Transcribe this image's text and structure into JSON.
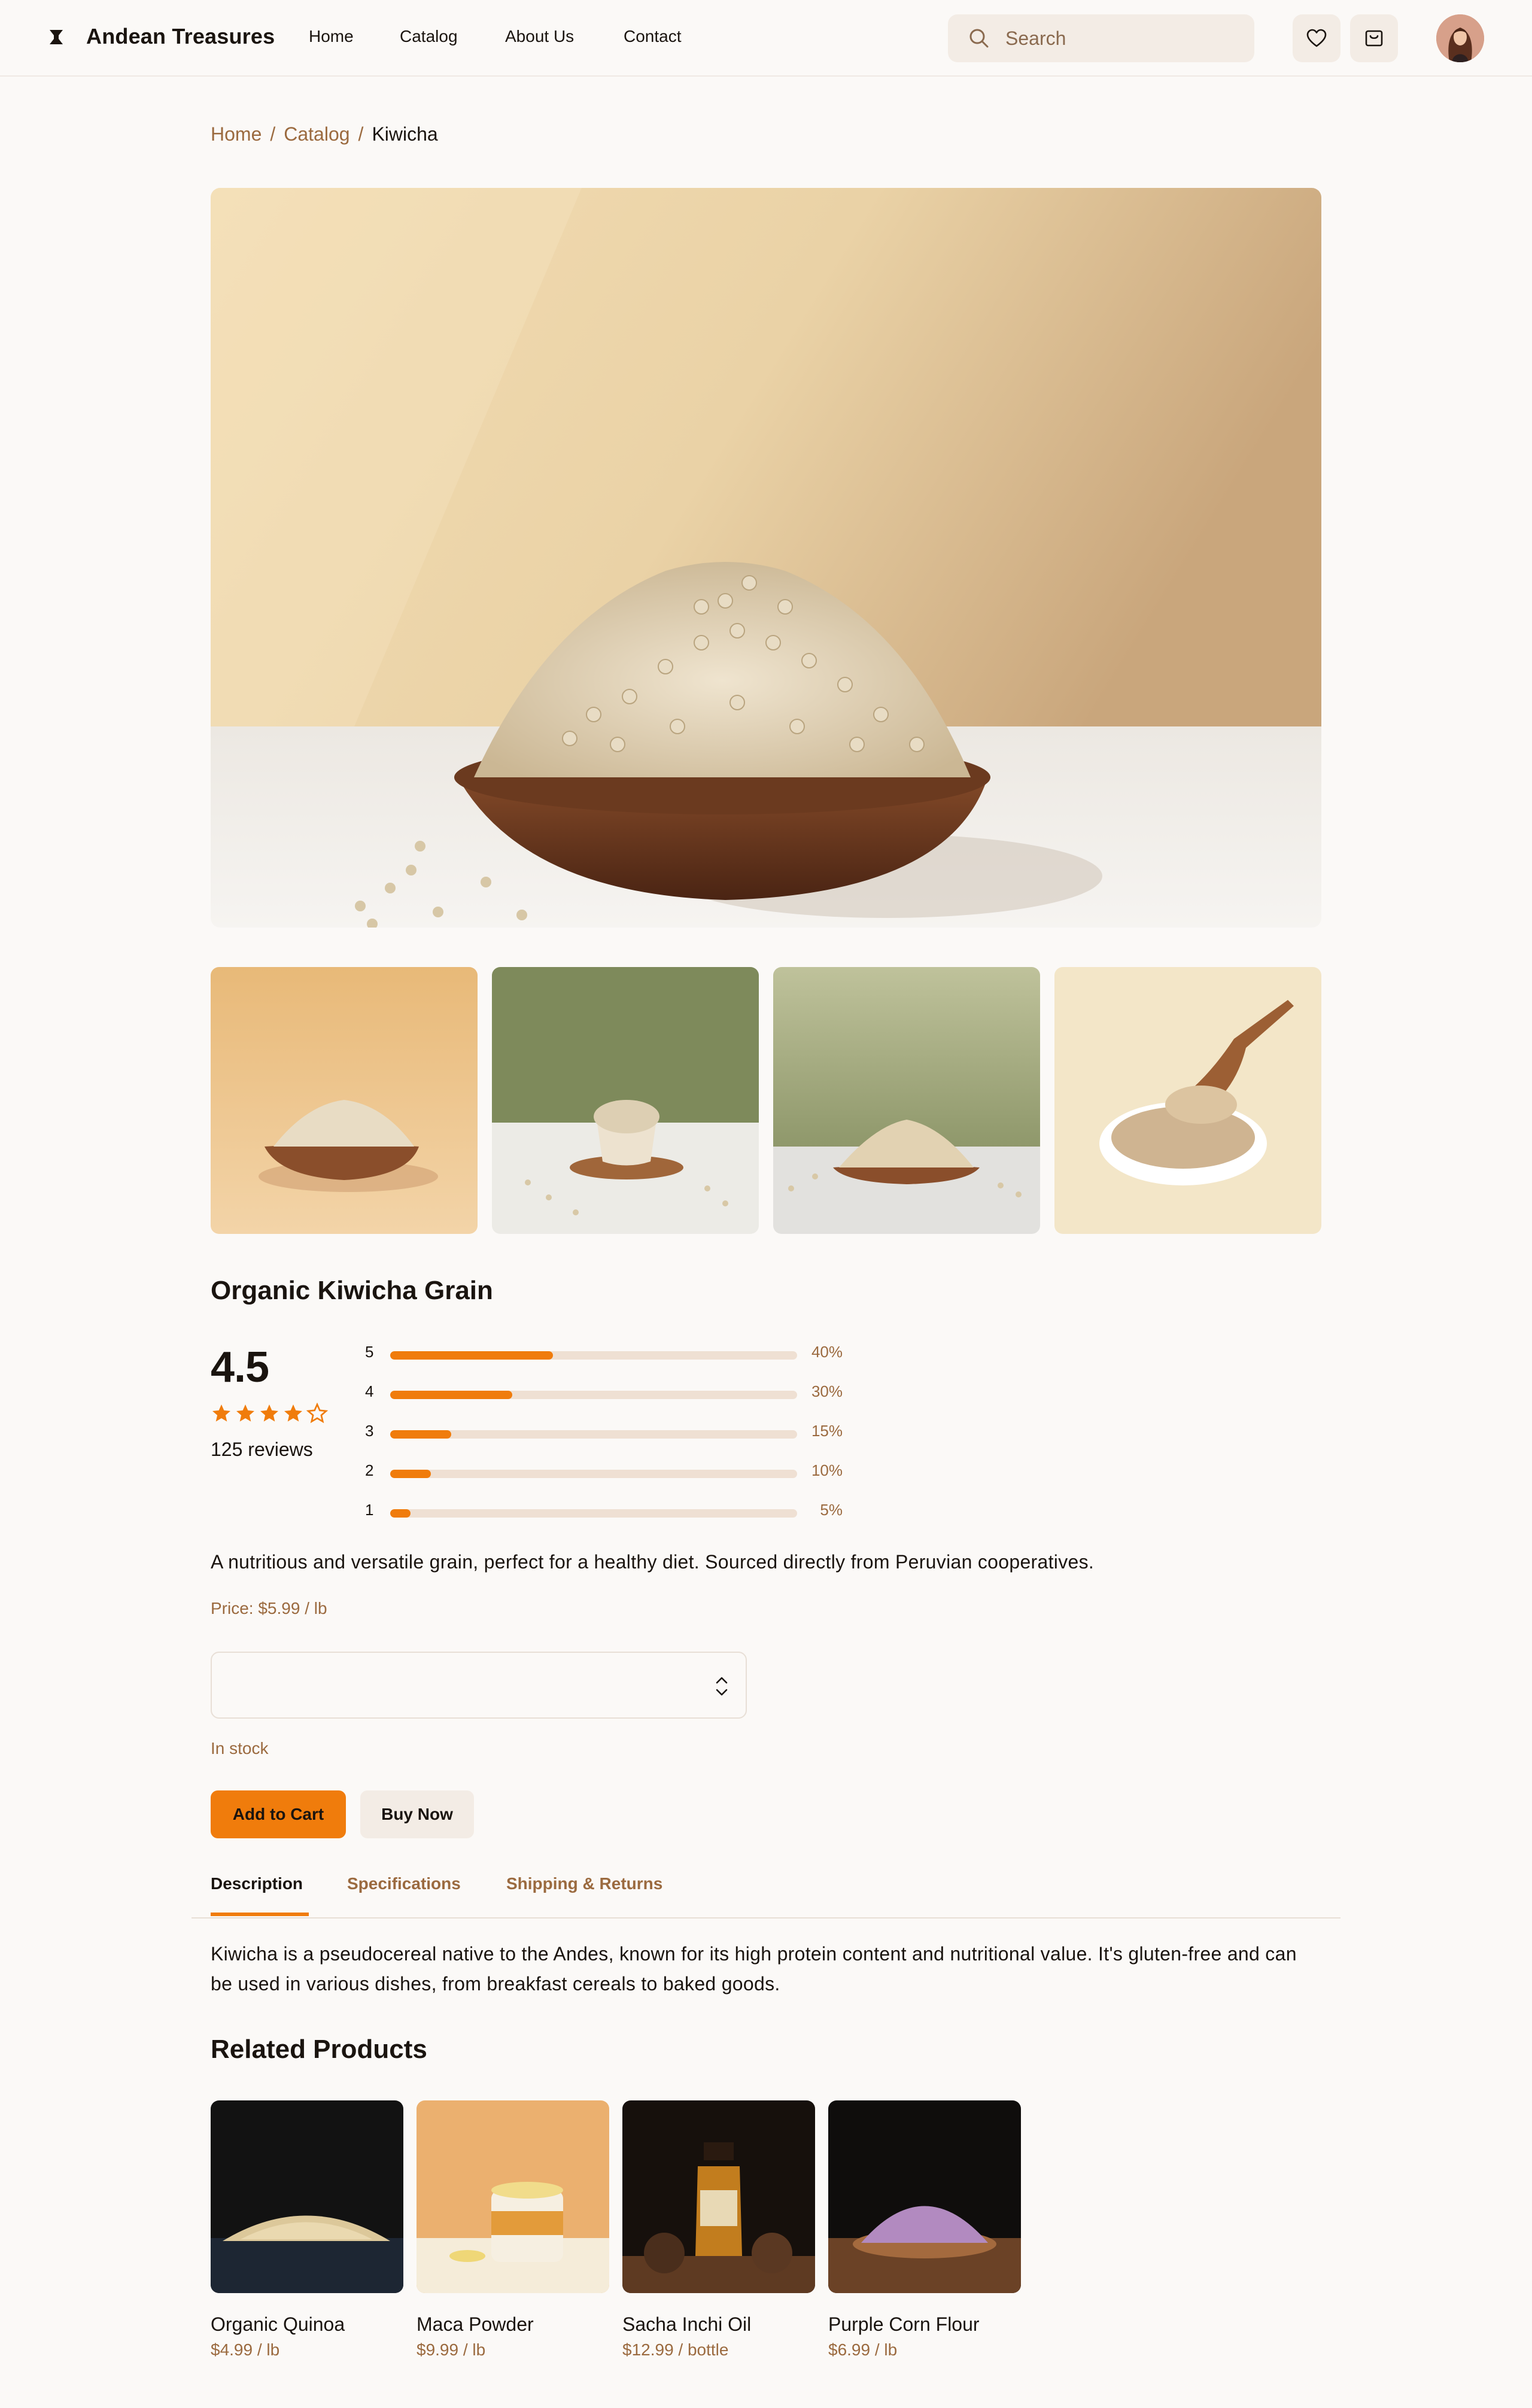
{
  "header": {
    "brand": "Andean Treasures",
    "nav": [
      "Home",
      "Catalog",
      "About Us",
      "Contact"
    ],
    "search_placeholder": "Search",
    "icons": [
      "logo-icon",
      "search-icon",
      "heart-icon",
      "cart-icon",
      "user-avatar"
    ]
  },
  "breadcrumb": [
    "Home",
    "Catalog",
    "Kiwicha"
  ],
  "product": {
    "title": "Organic Kiwicha Grain",
    "rating": "4.5",
    "stars_filled": 4,
    "stars_total": 5,
    "reviews": "125 reviews",
    "distribution": [
      {
        "stars": "5",
        "percent": 40,
        "label": "40%"
      },
      {
        "stars": "4",
        "percent": 30,
        "label": "30%"
      },
      {
        "stars": "3",
        "percent": 15,
        "label": "15%"
      },
      {
        "stars": "2",
        "percent": 10,
        "label": "10%"
      },
      {
        "stars": "1",
        "percent": 5,
        "label": "5%"
      }
    ],
    "short_description": "A nutritious and versatile grain, perfect for a healthy diet. Sourced directly from Peruvian cooperatives.",
    "price": "Price: $5.99 / lb",
    "quantity_value": "",
    "stock": "In stock",
    "add_to_cart": "Add to Cart",
    "buy_now": "Buy Now"
  },
  "tabs": {
    "items": [
      "Description",
      "Specifications",
      "Shipping & Returns"
    ],
    "active": "Description",
    "description": "Kiwicha is a pseudocereal native to the Andes, known for its high protein content and nutritional value. It's gluten-free and can be used in various dishes, from breakfast cereals to baked goods."
  },
  "related": {
    "title": "Related Products",
    "items": [
      {
        "name": "Organic Quinoa",
        "price": "$4.99 / lb"
      },
      {
        "name": "Maca Powder",
        "price": "$9.99 / lb"
      },
      {
        "name": "Sacha Inchi Oil",
        "price": "$12.99 / bottle"
      },
      {
        "name": "Purple Corn Flour",
        "price": "$6.99 / lb"
      }
    ]
  },
  "colors": {
    "accent": "#f07c0c",
    "link": "#9b6a3f",
    "background": "#fbf9f7",
    "surface": "#f3ece5"
  }
}
